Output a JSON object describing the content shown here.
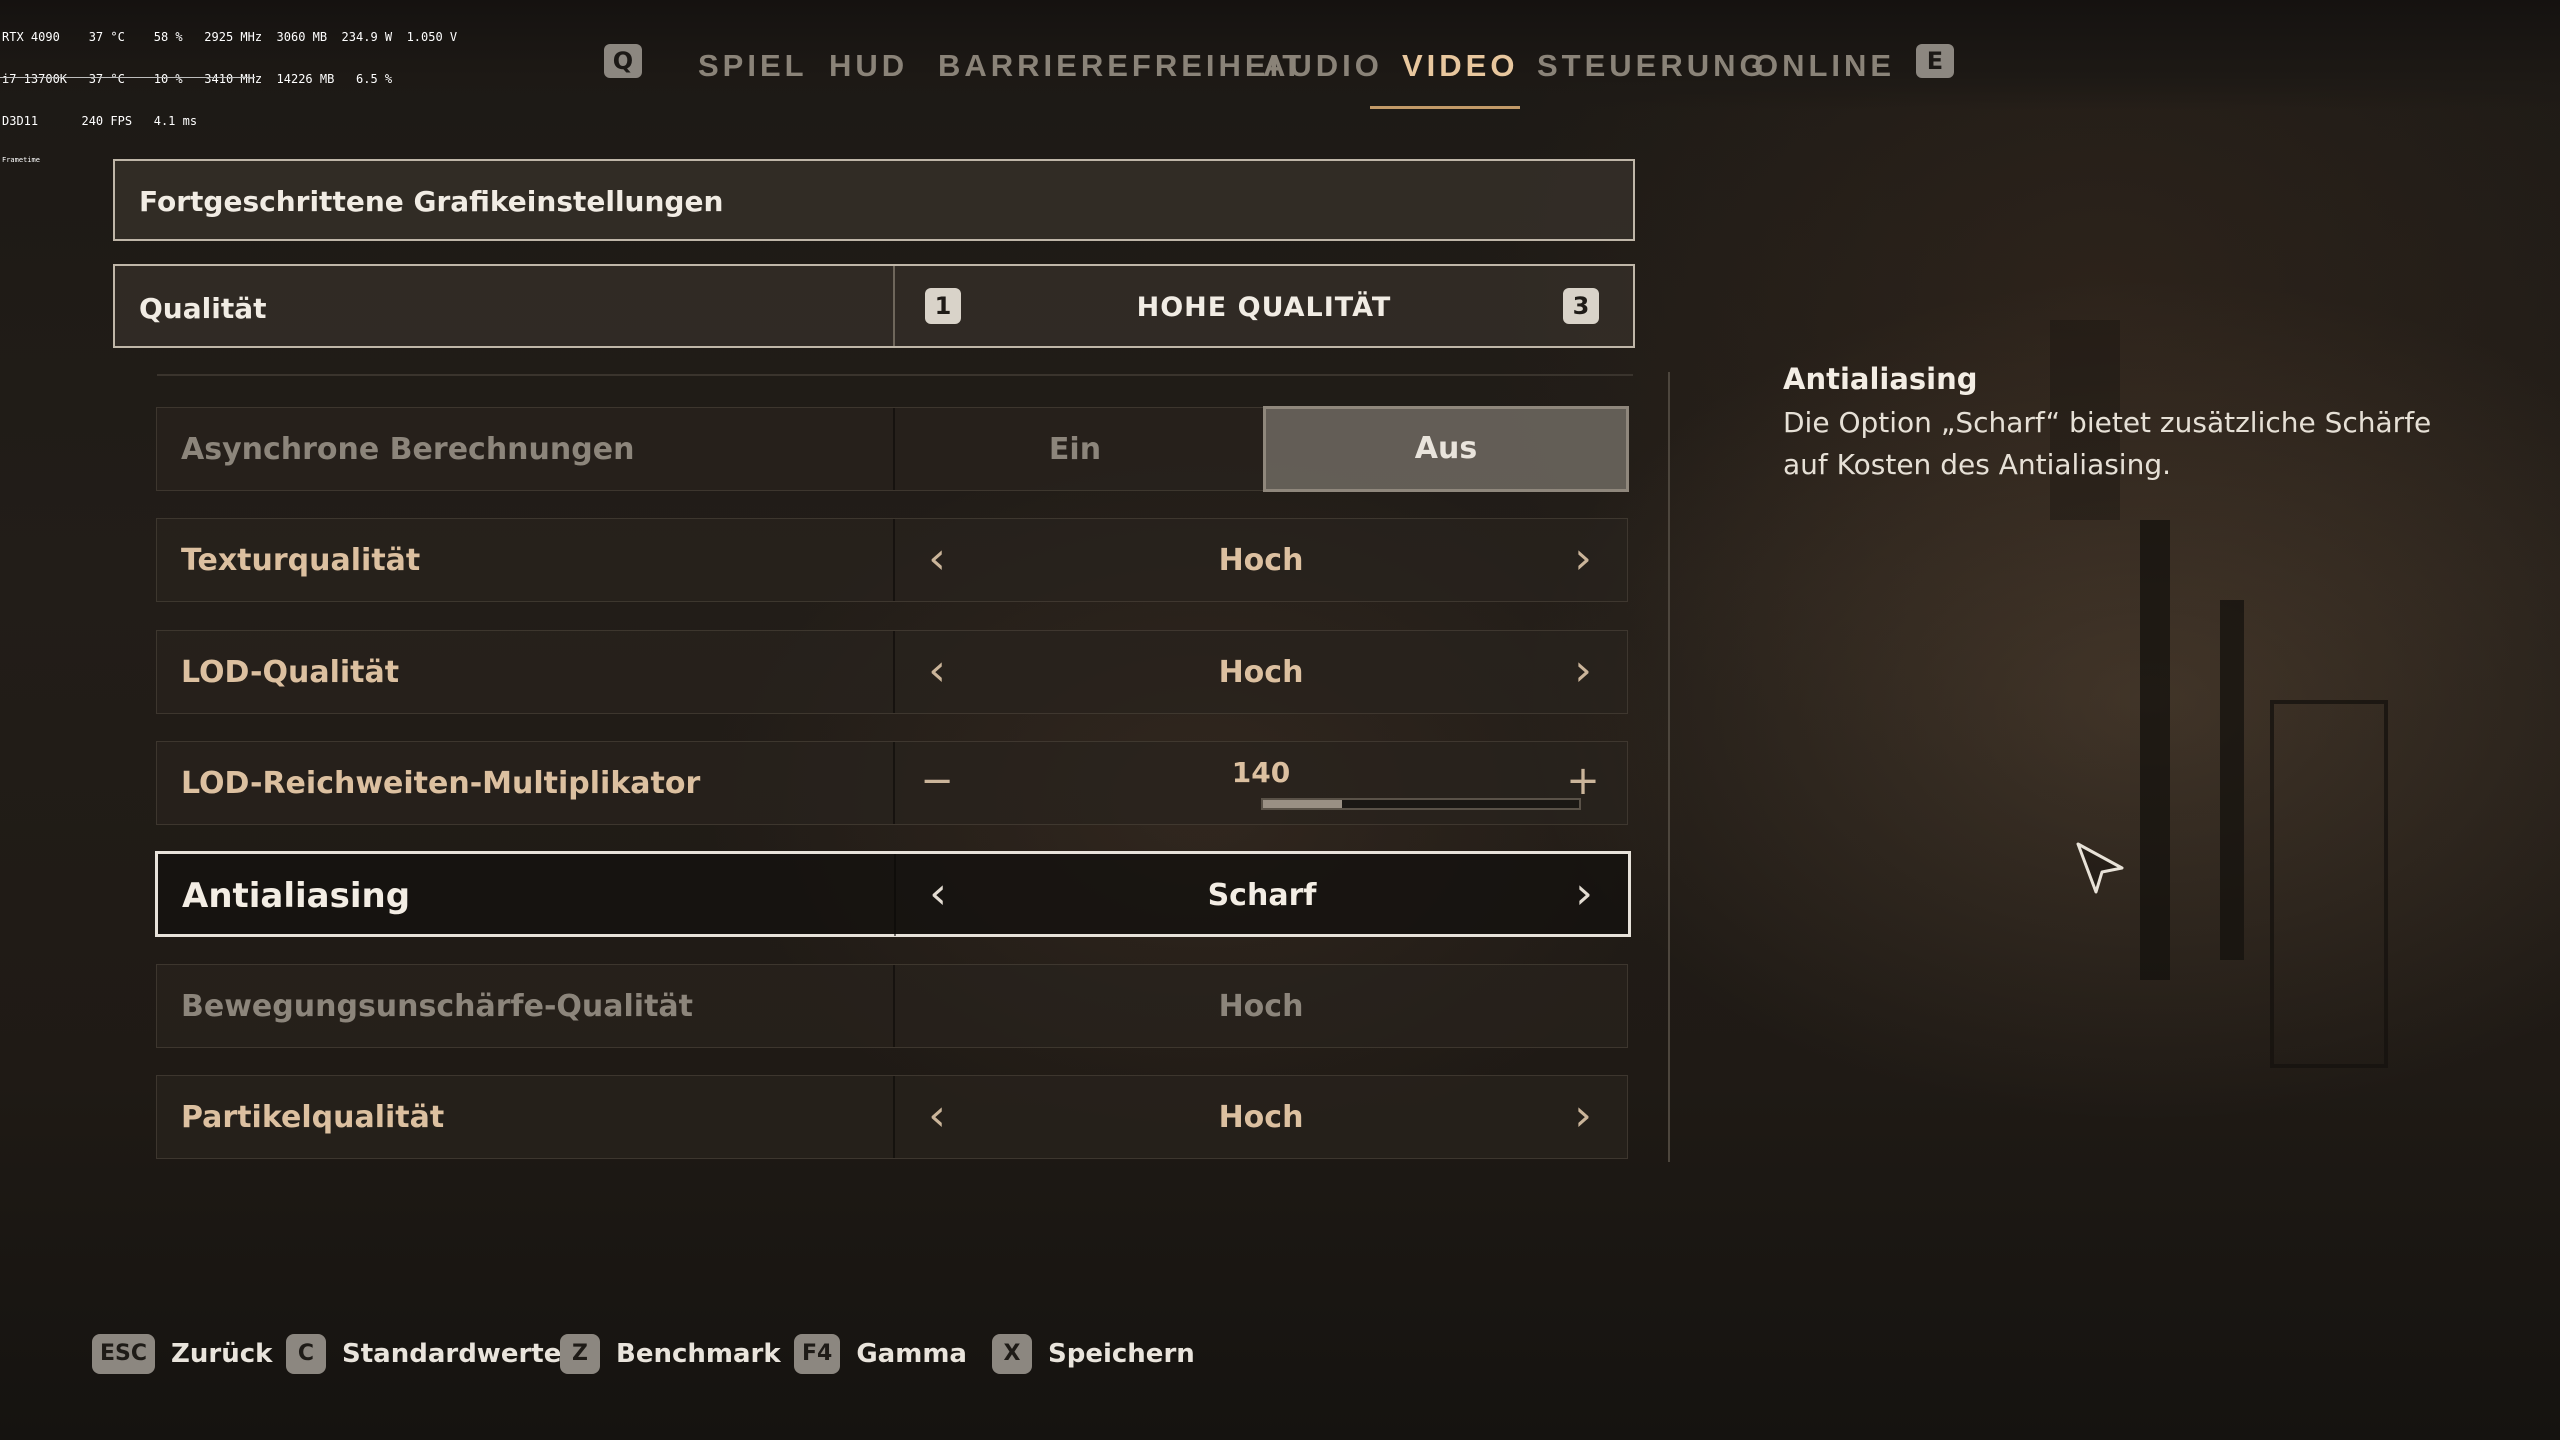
{
  "perf_overlay": {
    "lines": [
      "RTX 4090    37 °C    58 %   2925 MHz  3060 MB  234.9 W  1.050 V",
      "i7 13700K   37 °C    10 %   3410 MHz  14226 MB   6.5 %",
      "D3D11      240 FPS   4.1 ms",
      "Frametime"
    ]
  },
  "nav": {
    "left_key": "Q",
    "right_key": "E",
    "tabs": [
      "SPIEL",
      "HUD",
      "BARRIEREFREIHEIT",
      "AUDIO",
      "VIDEO",
      "STEUERUNG",
      "ONLINE"
    ],
    "active_tab": "VIDEO"
  },
  "panel": {
    "header": "Fortgeschrittene Grafikeinstellungen",
    "quality": {
      "label": "Qualität",
      "value": "HOHE QUALITÄT",
      "key_prev": "1",
      "key_next": "3"
    },
    "rows": {
      "async": {
        "label": "Asynchrone Berechnungen",
        "option_on": "Ein",
        "option_off": "Aus",
        "selected": "Aus"
      },
      "texture": {
        "label": "Texturqualität",
        "value": "Hoch"
      },
      "lod": {
        "label": "LOD-Qualität",
        "value": "Hoch"
      },
      "lod_range": {
        "label": "LOD-Reichweiten-Multiplikator",
        "value": "140",
        "fill_fraction": 0.25,
        "minus": "−",
        "plus": "+"
      },
      "antialiasing": {
        "label": "Antialiasing",
        "value": "Scharf"
      },
      "motion_blur": {
        "label": "Bewegungsunschärfe-Qualität",
        "value": "Hoch"
      },
      "particles": {
        "label": "Partikelqualität",
        "value": "Hoch"
      }
    }
  },
  "description": {
    "title": "Antialiasing",
    "text": "Die Option „Scharf“ bietet zusätzliche Schärfe auf Kosten des Antialiasing."
  },
  "hints": [
    {
      "key": "ESC",
      "label": "Zurück"
    },
    {
      "key": "C",
      "label": "Standardwerte"
    },
    {
      "key": "Z",
      "label": "Benchmark"
    },
    {
      "key": "F4",
      "label": "Gamma"
    },
    {
      "key": "X",
      "label": "Speichern"
    }
  ],
  "colors": {
    "accent": "#c29a68",
    "label": "#dcc0a0",
    "disabled": "#8c857b",
    "selected_border": "#e7e2da"
  }
}
